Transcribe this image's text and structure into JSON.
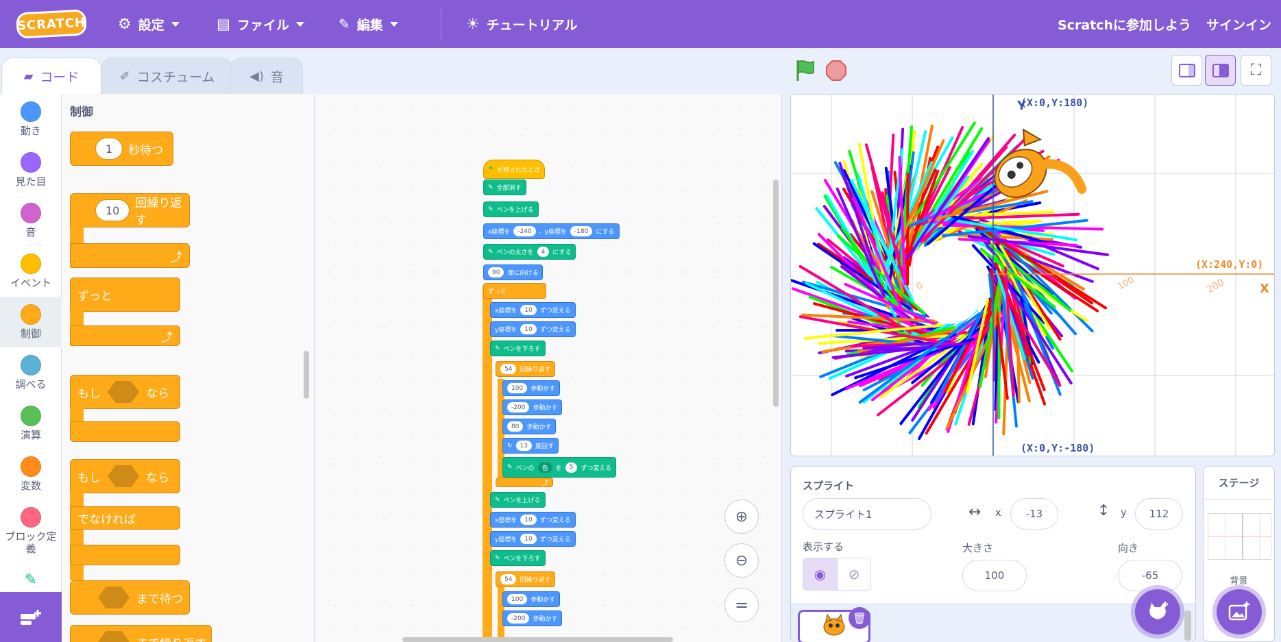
{
  "menubar": {
    "logo": "SCRATCH",
    "settings": "設定",
    "file": "ファイル",
    "edit": "編集",
    "tutorials": "チュートリアル",
    "join": "Scratchに参加しよう",
    "signin": "サインイン"
  },
  "tabs": {
    "code": "コード",
    "costumes": "コスチューム",
    "sounds": "音"
  },
  "categories": [
    {
      "label": "動き",
      "color": "#4c97ff"
    },
    {
      "label": "見た目",
      "color": "#9966ff"
    },
    {
      "label": "音",
      "color": "#cf63cf"
    },
    {
      "label": "イベント",
      "color": "#ffbf00"
    },
    {
      "label": "制御",
      "color": "#ffab19"
    },
    {
      "label": "調べる",
      "color": "#5cb1d6"
    },
    {
      "label": "演算",
      "color": "#59c059"
    },
    {
      "label": "変数",
      "color": "#ff8c1a"
    },
    {
      "label": "ブロック定義",
      "color": "#ff6680"
    }
  ],
  "palette": {
    "title": "制御",
    "wait_value": "1",
    "wait_label": "秒待つ",
    "repeat_value": "10",
    "repeat_label": "回繰り返す",
    "forever_label": "ずっと",
    "if_label": "もし",
    "then_label": "なら",
    "else_label": "でなければ",
    "wait_until_label": "まで待つ",
    "repeat_until_label": "まで繰り返す"
  },
  "script": {
    "flag_hat": "が押されたとき",
    "clear": "全部消す",
    "pen_up": "ペンを上げる",
    "goto_x_label": "x座標を",
    "goto_x_value": "-240",
    "goto_y_label": "y座標を",
    "goto_y_value": "-180",
    "goto_suffix": "にする",
    "set_size_label": "ペンの太さを",
    "set_size_value": "4",
    "set_size_suffix": "にする",
    "point_value": "90",
    "point_label": "度に向ける",
    "forever": "ずっと",
    "change_x_label": "x座標を",
    "change_x_value": "10",
    "change_suffix": "ずつ変える",
    "change_y_label": "y座標を",
    "change_y_value": "10",
    "pen_down": "ペンを下ろす",
    "repeat_value": "54",
    "repeat_label": "回繰り返す",
    "move1": "100",
    "move2": "-200",
    "move3": "80",
    "move_label": "歩動かす",
    "turn_value": "13",
    "turn_label": "度回す",
    "pen_change_label": "ペンの",
    "pen_change_param": "色",
    "pen_change_by": "を",
    "pen_change_value": "5",
    "pen_change_suffix": "ずつ変える",
    "pen_up2": "ペンを上げる",
    "change_x2_value": "10",
    "change_y2_value": "10",
    "pen_down2": "ペンを下ろす",
    "repeat2_value": "54",
    "move4": "100",
    "move5": "-200"
  },
  "stage": {
    "top_label": "(X:0,Y:180)",
    "right_label": "(X:240,Y:0)",
    "bottom_label": "(X:0,Y:-180)",
    "y_axis": "Y",
    "x_axis": "X",
    "tick_100": "100",
    "tick_200": "200",
    "tick_neg": "0"
  },
  "sprite": {
    "header": "スプライト",
    "name": "スプライト1",
    "x_label": "x",
    "x_value": "-13",
    "y_label": "y",
    "y_value": "112",
    "show_label": "表示する",
    "size_label": "大きさ",
    "size_value": "100",
    "direction_label": "向き",
    "direction_value": "-65"
  },
  "stage_panel": {
    "title": "ステージ",
    "backdrop_label": "背景"
  },
  "colors": {
    "accent": "#855cd6",
    "control": "#ffab19",
    "motion": "#4c97ff",
    "pen": "#0fbd8c",
    "events": "#ffbf00"
  }
}
